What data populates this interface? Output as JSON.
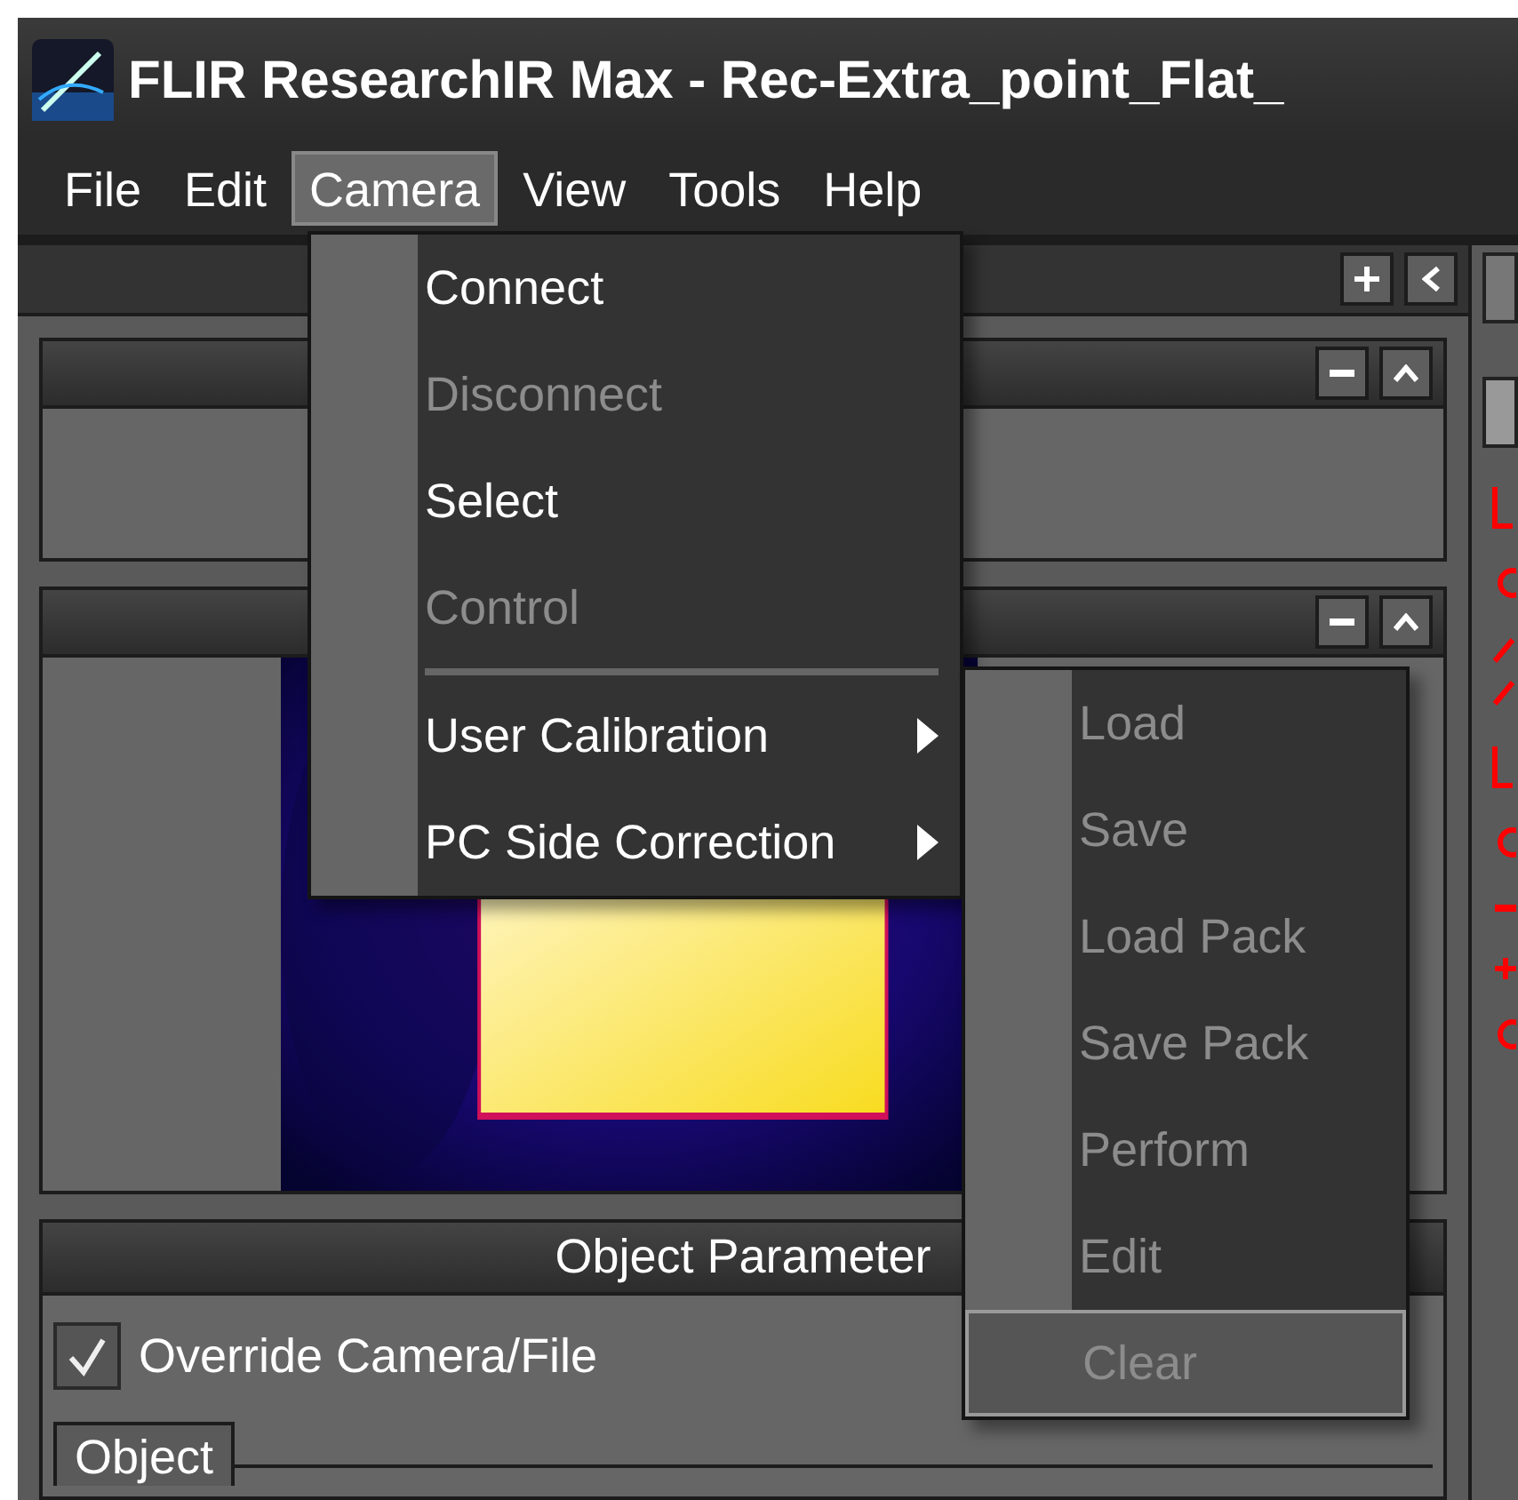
{
  "window": {
    "title": "FLIR ResearchIR Max - Rec-Extra_point_Flat_"
  },
  "menu_bar": [
    {
      "label": "File",
      "selected": false
    },
    {
      "label": "Edit",
      "selected": false
    },
    {
      "label": "Camera",
      "selected": true
    },
    {
      "label": "View",
      "selected": false
    },
    {
      "label": "Tools",
      "selected": false
    },
    {
      "label": "Help",
      "selected": false
    }
  ],
  "camera_menu": [
    {
      "kind": "item",
      "label": "Connect",
      "disabled": false
    },
    {
      "kind": "item",
      "label": "Disconnect",
      "disabled": true
    },
    {
      "kind": "item",
      "label": "Select",
      "disabled": false
    },
    {
      "kind": "item",
      "label": "Control",
      "disabled": true
    },
    {
      "kind": "separator"
    },
    {
      "kind": "submenu",
      "label": "User Calibration",
      "disabled": false
    },
    {
      "kind": "submenu",
      "label": "PC Side Correction",
      "disabled": false
    }
  ],
  "calibration_submenu": [
    {
      "label": "Load",
      "disabled": true,
      "selected": false
    },
    {
      "label": "Save",
      "disabled": true,
      "selected": false
    },
    {
      "label": "Load Pack",
      "disabled": true,
      "selected": false
    },
    {
      "label": "Save Pack",
      "disabled": true,
      "selected": false
    },
    {
      "label": "Perform",
      "disabled": true,
      "selected": false
    },
    {
      "label": "Edit",
      "disabled": true,
      "selected": false
    },
    {
      "label": "Clear",
      "disabled": true,
      "selected": true
    }
  ],
  "object_panel": {
    "title": "Object Parameter",
    "override": {
      "label": "Override Camera/File",
      "checked": true
    },
    "group_label": "Object"
  }
}
